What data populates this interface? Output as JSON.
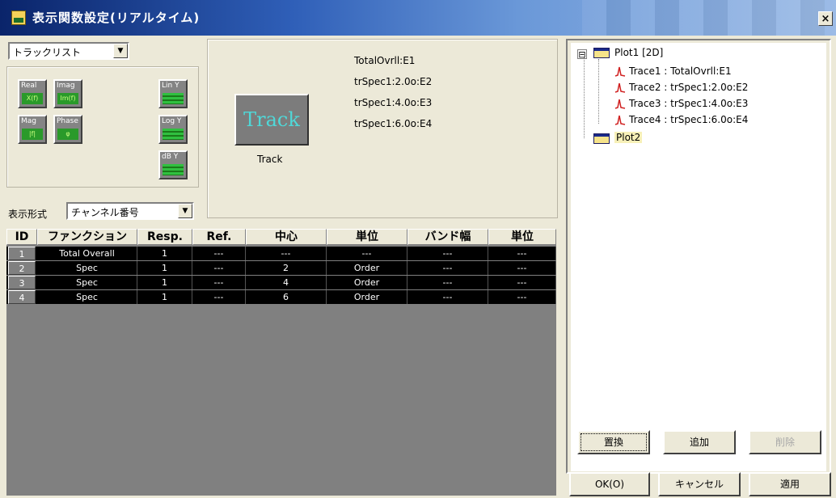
{
  "window": {
    "title": "表示関数設定(リアルタイム)",
    "close_label": "×"
  },
  "top_left": {
    "source_combo": "トラックリスト",
    "display_format_label": "表示形式",
    "display_format_combo": "チャンネル番号",
    "buttons": {
      "real": "Real",
      "real_sub": "X(f)",
      "imag": "Imag",
      "imag_sub": "Im(f)",
      "mag": "Mag",
      "mag_sub": "|f|",
      "phase": "Phase",
      "phase_sub": "φ",
      "liny": "Lin Y",
      "logy": "Log Y",
      "dby": "dB Y"
    }
  },
  "track": {
    "button_label": "Track",
    "caption": "Track",
    "lines": [
      "TotalOvrll:E1",
      "trSpec1:2.0o:E2",
      "trSpec1:4.0o:E3",
      "trSpec1:6.0o:E4"
    ]
  },
  "table": {
    "headers": [
      "ID",
      "ファンクション",
      "Resp.",
      "Ref.",
      "中心",
      "単位",
      "バンド幅",
      "単位"
    ],
    "rows": [
      [
        "1",
        "Total Overall",
        "1",
        "---",
        "---",
        "---",
        "---",
        "---"
      ],
      [
        "2",
        "Spec",
        "1",
        "---",
        "2",
        "Order",
        "---",
        "---"
      ],
      [
        "3",
        "Spec",
        "1",
        "---",
        "4",
        "Order",
        "---",
        "---"
      ],
      [
        "4",
        "Spec",
        "1",
        "---",
        "6",
        "Order",
        "---",
        "---"
      ]
    ]
  },
  "tree": {
    "expander": "⊟",
    "plot1": "Plot1 [2D]",
    "traces": [
      "Trace1 : TotalOvrll:E1",
      "Trace2 : trSpec1:2.0o:E2",
      "Trace3 : trSpec1:4.0o:E3",
      "Trace4 : trSpec1:6.0o:E4"
    ],
    "plot2": "Plot2"
  },
  "tree_buttons": {
    "replace": "置換",
    "add": "追加",
    "delete": "削除"
  },
  "footer_buttons": {
    "ok": "OK(O)",
    "cancel": "キャンセル",
    "apply": "適用"
  },
  "colors": {
    "accent_track_text": "#4fd8d8",
    "trace_icon": "#d02020",
    "title_bar": "#0a246a"
  }
}
